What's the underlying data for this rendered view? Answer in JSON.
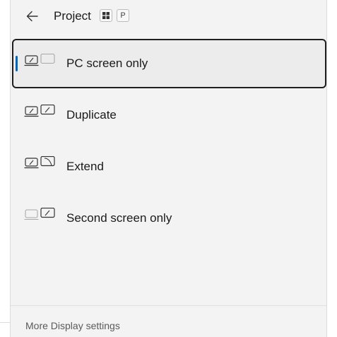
{
  "header": {
    "back_icon": "arrow-left-icon",
    "title": "Project",
    "shortcut_keys": {
      "windows_key_icon": "windows-logo-icon",
      "letter_key": "P"
    }
  },
  "options": [
    {
      "label": "PC screen only",
      "icon": "pc-screen-only-icon",
      "selected": true
    },
    {
      "label": "Duplicate",
      "icon": "duplicate-icon",
      "selected": false
    },
    {
      "label": "Extend",
      "icon": "extend-icon",
      "selected": false
    },
    {
      "label": "Second screen only",
      "icon": "second-screen-only-icon",
      "selected": false
    }
  ],
  "footer": {
    "link_label": "More Display settings"
  },
  "colors": {
    "accent": "#0067c0",
    "panel_bg": "#f3f3f3",
    "selected_border": "#1f1f1f"
  }
}
